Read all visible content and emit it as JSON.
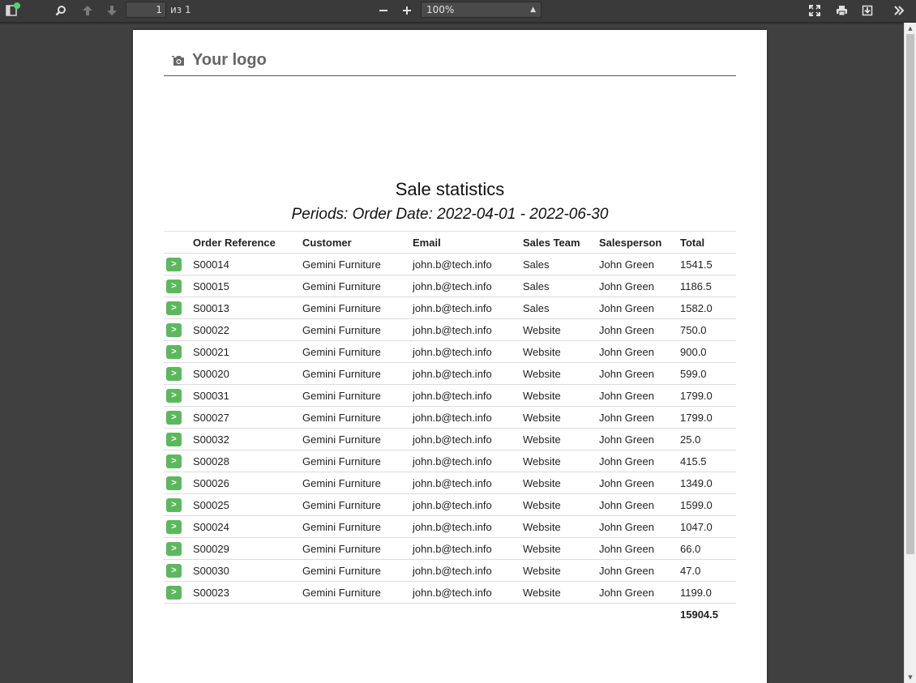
{
  "toolbar": {
    "page_number": "1",
    "page_of": "из 1",
    "zoom_value": "100%"
  },
  "report": {
    "logo_text": "Your logo",
    "title": "Sale statistics",
    "subtitle": "Periods: Order Date: 2022-04-01 - 2022-06-30",
    "row_button_label": ">",
    "columns": [
      "Order Reference",
      "Customer",
      "Email",
      "Sales Team",
      "Salesperson",
      "Total"
    ],
    "rows": [
      [
        "S00014",
        "Gemini Furniture",
        "john.b@tech.info",
        "Sales",
        "John Green",
        "1541.5"
      ],
      [
        "S00015",
        "Gemini Furniture",
        "john.b@tech.info",
        "Sales",
        "John Green",
        "1186.5"
      ],
      [
        "S00013",
        "Gemini Furniture",
        "john.b@tech.info",
        "Sales",
        "John Green",
        "1582.0"
      ],
      [
        "S00022",
        "Gemini Furniture",
        "john.b@tech.info",
        "Website",
        "John Green",
        "750.0"
      ],
      [
        "S00021",
        "Gemini Furniture",
        "john.b@tech.info",
        "Website",
        "John Green",
        "900.0"
      ],
      [
        "S00020",
        "Gemini Furniture",
        "john.b@tech.info",
        "Website",
        "John Green",
        "599.0"
      ],
      [
        "S00031",
        "Gemini Furniture",
        "john.b@tech.info",
        "Website",
        "John Green",
        "1799.0"
      ],
      [
        "S00027",
        "Gemini Furniture",
        "john.b@tech.info",
        "Website",
        "John Green",
        "1799.0"
      ],
      [
        "S00032",
        "Gemini Furniture",
        "john.b@tech.info",
        "Website",
        "John Green",
        "25.0"
      ],
      [
        "S00028",
        "Gemini Furniture",
        "john.b@tech.info",
        "Website",
        "John Green",
        "415.5"
      ],
      [
        "S00026",
        "Gemini Furniture",
        "john.b@tech.info",
        "Website",
        "John Green",
        "1349.0"
      ],
      [
        "S00025",
        "Gemini Furniture",
        "john.b@tech.info",
        "Website",
        "John Green",
        "1599.0"
      ],
      [
        "S00024",
        "Gemini Furniture",
        "john.b@tech.info",
        "Website",
        "John Green",
        "1047.0"
      ],
      [
        "S00029",
        "Gemini Furniture",
        "john.b@tech.info",
        "Website",
        "John Green",
        "66.0"
      ],
      [
        "S00030",
        "Gemini Furniture",
        "john.b@tech.info",
        "Website",
        "John Green",
        "47.0"
      ],
      [
        "S00023",
        "Gemini Furniture",
        "john.b@tech.info",
        "Website",
        "John Green",
        "1199.0"
      ]
    ],
    "grand_total": "15904.5"
  },
  "icons": {
    "sidebar": "sidebar-toggle-icon",
    "search": "search-icon",
    "prev": "arrow-up-icon",
    "next": "arrow-down-icon",
    "zoom_out": "minus-icon",
    "zoom_in": "plus-icon",
    "fullscreen": "fullscreen-icon",
    "print": "print-icon",
    "download": "download-icon",
    "more": "double-chevron-right-icon",
    "logo": "camera-icon"
  },
  "colors": {
    "toolbar_bg": "#3a3a3a",
    "viewer_bg": "#404040",
    "button_green": "#5cb85c",
    "notification_dot": "#4cd964"
  }
}
